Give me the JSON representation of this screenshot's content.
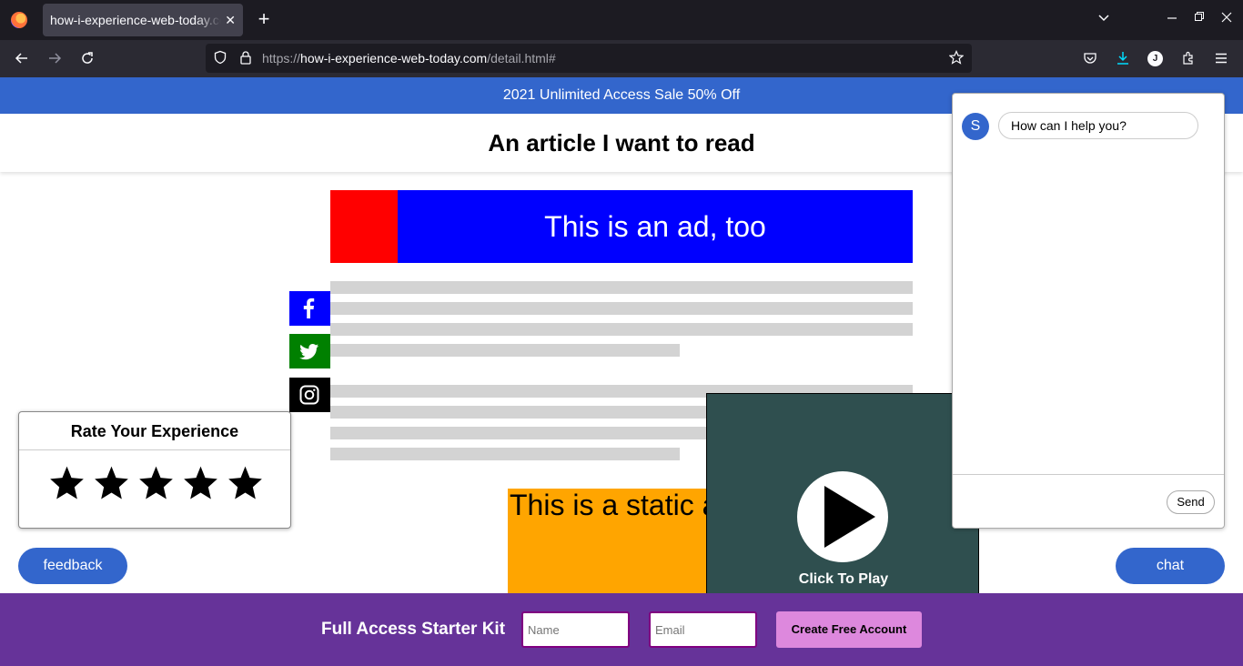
{
  "browser": {
    "tab_title": "how-i-experience-web-today.com/detail.html",
    "tab_close": "✕",
    "new_tab": "+",
    "url_prefix": "https://",
    "url_host": "how-i-experience-web-today.com",
    "url_path": "/detail.html#",
    "profile_initial": "J"
  },
  "page": {
    "promo_text": "2021 Unlimited Access Sale 50% Off",
    "title": "An article I want to read",
    "ad_banner_text": "This is an ad, too",
    "static_ad_text": "This is a static ad",
    "video_label": "Click To Play"
  },
  "rating": {
    "title": "Rate Your Experience",
    "stars": 5
  },
  "buttons": {
    "feedback": "feedback",
    "chat": "chat"
  },
  "chat": {
    "avatar_initial": "S",
    "message": "How can I help you?",
    "send_label": "Send"
  },
  "signup": {
    "label": "Full Access Starter Kit",
    "name_placeholder": "Name",
    "email_placeholder": "Email",
    "submit_label": "Create Free Account"
  },
  "colors": {
    "promo": "#3366cc",
    "facebook": "#0000ff",
    "twitter": "#008000",
    "instagram": "#000000",
    "signup_bar": "#663399",
    "create_button": "#dd88dd"
  },
  "icons": [
    "firefox-logo-icon",
    "back-arrow-icon",
    "forward-arrow-icon",
    "reload-icon",
    "shield-icon",
    "lock-icon",
    "bookmark-star-icon",
    "pocket-icon",
    "download-icon",
    "extensions-icon",
    "menu-icon",
    "facebook-icon",
    "twitter-icon",
    "instagram-icon",
    "play-icon",
    "star-icon"
  ]
}
